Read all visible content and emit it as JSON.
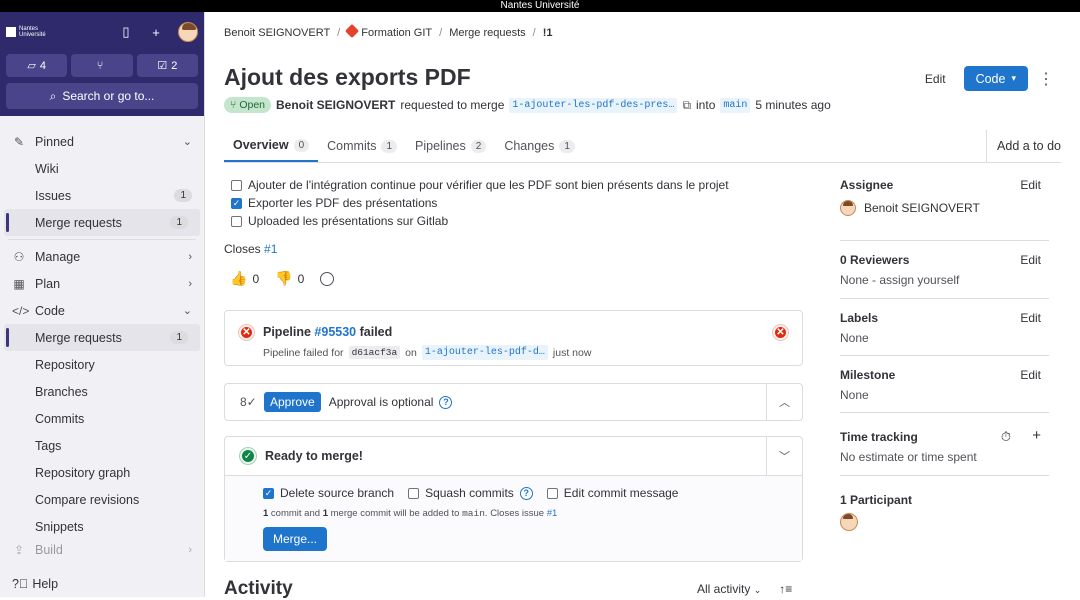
{
  "window": {
    "title": "Nantes Université"
  },
  "brand": {
    "logo_text": "Nantes Université"
  },
  "counters": [
    {
      "icon": "issues-icon",
      "value": "4"
    },
    {
      "icon": "merge-request-icon",
      "value": ""
    },
    {
      "icon": "todo-icon",
      "value": "2"
    }
  ],
  "search": {
    "label": "Search or go to..."
  },
  "sidebar": {
    "items": [
      {
        "label": "Pinned",
        "icon": "pin-icon",
        "chev": "⌄",
        "count": ""
      },
      {
        "label": "Wiki",
        "count": ""
      },
      {
        "label": "Issues",
        "count": "1"
      },
      {
        "label": "Merge requests",
        "count": "1"
      },
      {
        "label": "Manage",
        "icon": "users-icon",
        "chev": "›",
        "count": ""
      },
      {
        "label": "Plan",
        "icon": "calendar-icon",
        "chev": "›",
        "count": ""
      },
      {
        "label": "Code",
        "icon": "code-icon",
        "chev": "⌄",
        "count": ""
      },
      {
        "label": "Merge requests",
        "count": "1"
      },
      {
        "label": "Repository",
        "count": ""
      },
      {
        "label": "Branches",
        "count": ""
      },
      {
        "label": "Commits",
        "count": ""
      },
      {
        "label": "Tags",
        "count": ""
      },
      {
        "label": "Repository graph",
        "count": ""
      },
      {
        "label": "Compare revisions",
        "count": ""
      },
      {
        "label": "Snippets",
        "count": ""
      },
      {
        "label": "Build",
        "icon": "rocket-icon",
        "chev": "›",
        "count": ""
      }
    ],
    "help": "Help"
  },
  "breadcrumb": {
    "user": "Benoit SEIGNOVERT",
    "project": "Formation GIT",
    "section": "Merge requests",
    "mr": "!1"
  },
  "mr": {
    "title": "Ajout des exports PDF",
    "status": "Open",
    "author": "Benoit SEIGNOVERT",
    "requested_text": "requested to merge",
    "source_branch": "1-ajouter-les-pdf-des-pres…",
    "into": "into",
    "target_branch": "main",
    "time": "5 minutes ago"
  },
  "actions": {
    "edit": "Edit",
    "code": "Code"
  },
  "tabs": [
    {
      "label": "Overview",
      "count": "0"
    },
    {
      "label": "Commits",
      "count": "1"
    },
    {
      "label": "Pipelines",
      "count": "2"
    },
    {
      "label": "Changes",
      "count": "1"
    }
  ],
  "todo": "Add a to do",
  "tasks": [
    {
      "text": "Ajouter de l'intégration continue pour vérifier que les PDF sont bien présents dans le projet",
      "checked": false
    },
    {
      "text": "Exporter les PDF des présentations",
      "checked": true
    },
    {
      "text": "Uploaded les présentations sur Gitlab",
      "checked": false
    }
  ],
  "closes": {
    "label": "Closes",
    "issue": "#1"
  },
  "reactions": {
    "thumbs_up": "0",
    "thumbs_down": "0"
  },
  "pipeline": {
    "prefix": "Pipeline",
    "id": "#95530",
    "status": "failed",
    "failed_for": "Pipeline failed for",
    "sha": "d61acf3a",
    "on": "on",
    "branch": "1-ajouter-les-pdf-d…",
    "when": "just now"
  },
  "approval": {
    "button": "Approve",
    "text": "Approval is optional"
  },
  "merge": {
    "title": "Ready to merge!",
    "delete_branch": "Delete source branch",
    "squash": "Squash commits",
    "edit_msg": "Edit commit message",
    "note_1": "1",
    "note_2": " commit and ",
    "note_3": "1",
    "note_4": " merge commit will be added to ",
    "note_5": "main",
    "note_6": ". Closes issue ",
    "note_7": "#1",
    "button": "Merge..."
  },
  "activity": {
    "title": "Activity",
    "filter": "All activity"
  },
  "right": {
    "assignee_label": "Assignee",
    "assignee": "Benoit SEIGNOVERT",
    "edit": "Edit",
    "reviewers_label": "0 Reviewers",
    "reviewers": "None - assign yourself",
    "labels_label": "Labels",
    "labels": "None",
    "milestone_label": "Milestone",
    "milestone": "None",
    "time_label": "Time tracking",
    "time": "No estimate or time spent",
    "participants_label": "1 Participant"
  },
  "colors": {
    "brand": "#2f2a6b",
    "accent": "#1f75cb",
    "danger": "#dd2b0e",
    "success": "#108548"
  }
}
